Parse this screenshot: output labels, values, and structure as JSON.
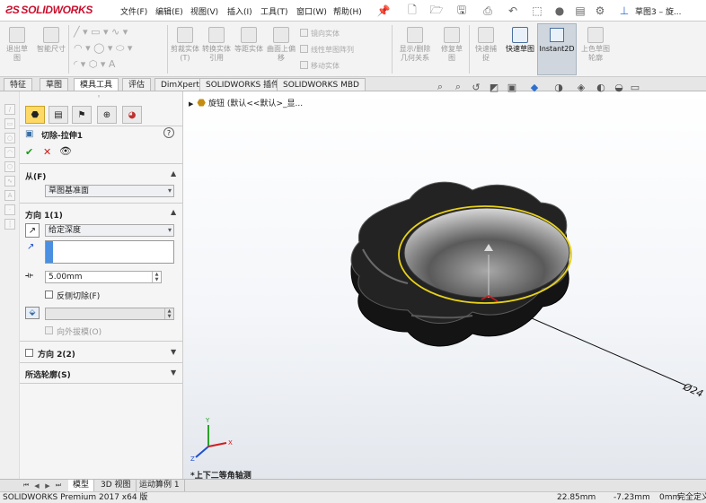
{
  "app": {
    "logo_text": "SOLIDWORKS",
    "document_title": "草图3 – 旋..."
  },
  "menu": [
    "文件(F)",
    "编辑(E)",
    "视图(V)",
    "插入(I)",
    "工具(T)",
    "窗口(W)",
    "帮助(H)"
  ],
  "commands": {
    "exit_sketch": "退出草图",
    "smart_dim": "智能尺寸",
    "trim": "剪裁实体(T)",
    "convert": "转换实体引用",
    "offset": "等距实体",
    "surface_offset": "曲面上偏移",
    "mirror": "镜向实体",
    "linear_pattern": "线性草图阵列",
    "move": "移动实体",
    "display_relations": "显示/删除几何关系",
    "repair": "修复草图",
    "quick_snaps": "快速捕捉",
    "rapid_sketch": "快速草图",
    "instant2d": "Instant2D",
    "shaded_contours": "上色草图轮廓"
  },
  "tabs": [
    "特征",
    "草图",
    "模具工具",
    "评估",
    "DimXpert",
    "SOLIDWORKS 插件",
    "SOLIDWORKS MBD"
  ],
  "active_tab": "模具工具",
  "tree": {
    "root": "旋钮 (默认<<默认>_显..."
  },
  "property_manager": {
    "title": "切除-拉伸1",
    "from_label": "从(F)",
    "from_value": "草图基准面",
    "direction1_label": "方向 1(1)",
    "end_condition": "给定深度",
    "depth": "5.00mm",
    "flip_side_label": "反侧切除(F)",
    "draft_outward_label": "向外拔模(O)",
    "direction2_label": "方向 2(2)",
    "contours_label": "所选轮廓(S)"
  },
  "graphics": {
    "view_label": "*上下二等角轴测",
    "dim_label": "Ø24"
  },
  "bottom_tabs": [
    "模型",
    "3D 视图",
    "运动算例 1"
  ],
  "status": {
    "product": "SOLIDWORKS Premium 2017 x64 版",
    "x": "22.85mm",
    "y": "-7.23mm",
    "z": "0mm",
    "state": "完全定义"
  }
}
